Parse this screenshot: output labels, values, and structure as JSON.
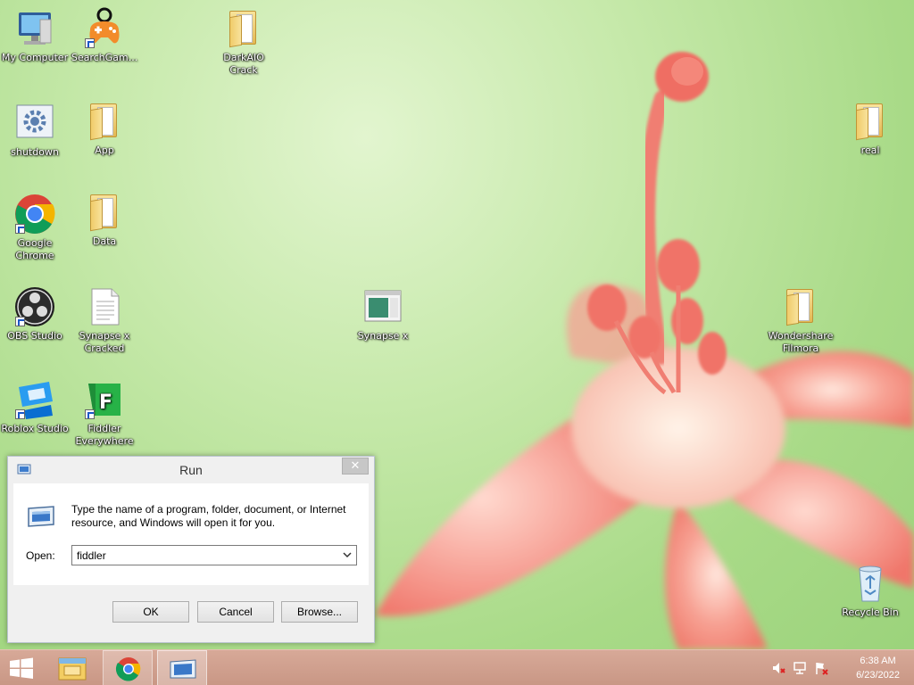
{
  "desktop": {
    "icons": [
      {
        "id": "my-computer",
        "label": "My Computer"
      },
      {
        "id": "searchgames",
        "label": "SearchGam..."
      },
      {
        "id": "darkaio",
        "label": "DarkAIO Crack"
      },
      {
        "id": "shutdown",
        "label": "shutdown"
      },
      {
        "id": "app",
        "label": "App"
      },
      {
        "id": "real",
        "label": "real"
      },
      {
        "id": "chrome",
        "label": "Google Chrome"
      },
      {
        "id": "data",
        "label": "Data"
      },
      {
        "id": "obs",
        "label": "OBS Studio"
      },
      {
        "id": "synapse-cracked",
        "label": "Synapse x Cracked"
      },
      {
        "id": "synapse",
        "label": "Synapse x"
      },
      {
        "id": "filmora",
        "label": "Wondershare Filmora"
      },
      {
        "id": "roblox",
        "label": "Roblox Studio"
      },
      {
        "id": "fiddler",
        "label": "Fiddler Everywhere"
      },
      {
        "id": "recycle",
        "label": "Recycle Bin"
      }
    ]
  },
  "run_dialog": {
    "title": "Run",
    "close_symbol": "✕",
    "description": "Type the name of a program, folder, document, or Internet resource, and Windows will open it for you.",
    "open_label": "Open:",
    "open_value": "fiddler",
    "ok_label": "OK",
    "cancel_label": "Cancel",
    "browse_label": "Browse..."
  },
  "taskbar": {
    "start_icon": "windows-logo-icon",
    "pinned": [
      "file-explorer-icon",
      "google-chrome-icon",
      "run-dialog-icon"
    ],
    "tray_icons": [
      "volume-muted-icon",
      "network-icon",
      "action-center-flag-icon"
    ],
    "time": "6:38 AM",
    "date": "6/23/2022"
  }
}
